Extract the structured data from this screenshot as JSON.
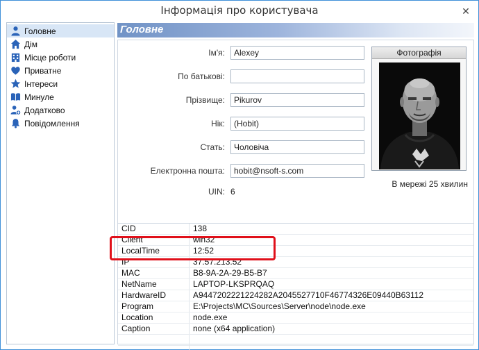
{
  "window": {
    "title": "Інформація про користувача"
  },
  "sidebar": {
    "items": [
      {
        "label": "Головне",
        "icon": "user-icon",
        "active": true
      },
      {
        "label": "Дім",
        "icon": "home-icon"
      },
      {
        "label": "Місце роботи",
        "icon": "building-icon"
      },
      {
        "label": "Приватне",
        "icon": "heart-icon"
      },
      {
        "label": "Інтереси",
        "icon": "star-icon"
      },
      {
        "label": "Минуле",
        "icon": "book-icon"
      },
      {
        "label": "Додатково",
        "icon": "user-add-icon"
      },
      {
        "label": "Повідомлення",
        "icon": "bell-icon"
      }
    ]
  },
  "section": {
    "title": "Головне"
  },
  "form": {
    "first_name_label": "Ім'я:",
    "first_name": "Alexey",
    "patronymic_label": "По батькові:",
    "patronymic": "",
    "last_name_label": "Прізвище:",
    "last_name": "Pikurov",
    "nick_label": "Нік:",
    "nick": "(Hobit)",
    "gender_label": "Стать:",
    "gender": "Чоловіча",
    "email_label": "Електронна пошта:",
    "email": "hobit@nsoft-s.com",
    "uin_label": "UIN:",
    "uin": "6"
  },
  "photo": {
    "header": "Фотографія",
    "online_status": "В мережі 25 хвилин"
  },
  "info_table": {
    "rows": [
      {
        "key": "CID",
        "value": "138"
      },
      {
        "key": "Client",
        "value": "win32"
      },
      {
        "key": "LocalTime",
        "value": "12:52"
      },
      {
        "key": "IP",
        "value": "37.57.213.52"
      },
      {
        "key": "MAC",
        "value": "B8-9A-2A-29-B5-B7"
      },
      {
        "key": "NetName",
        "value": "LAPTOP-LKSPRQAQ"
      },
      {
        "key": "HardwareID",
        "value": "A9447202221224282A2045527710F46774326E09440B63112"
      },
      {
        "key": "Program",
        "value": "E:\\Projects\\MC\\Sources\\Server\\node\\node.exe"
      },
      {
        "key": "Location",
        "value": "node.exe"
      },
      {
        "key": "Caption",
        "value": "none (x64 application)"
      }
    ]
  },
  "colors": {
    "accent": "#3f8fd8",
    "header_gradient_start": "#7193c6",
    "highlight": "#e0101a",
    "active_item": "#d8e6f6"
  }
}
